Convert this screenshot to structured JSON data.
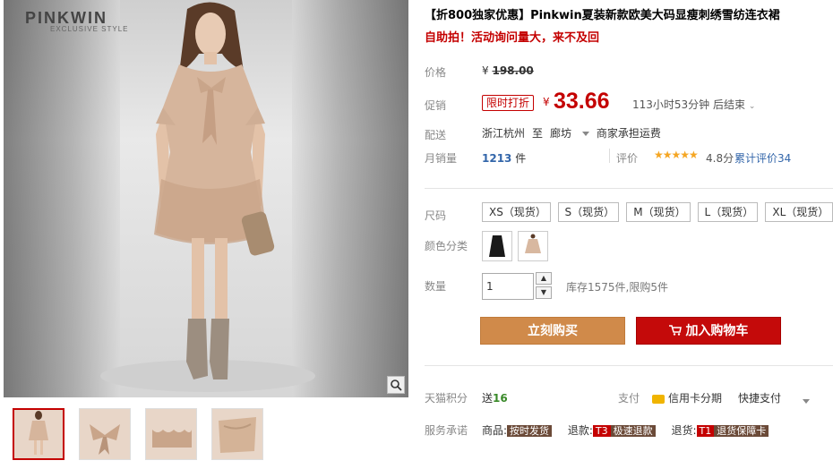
{
  "gallery": {
    "brand": "PINKWIN",
    "brand_sub": "EXCLUSIVE STYLE",
    "zoom_icon": "magnifier-icon",
    "thumbnails": [
      "model-full",
      "bow-detail",
      "ruffle-detail",
      "fabric-detail"
    ]
  },
  "product": {
    "title": "【折800独家优惠】Pinkwin夏装新款欧美大码显瘦刺绣雪纺连衣裙",
    "subtitle": "自助拍！活动询问量大，来不及回"
  },
  "price": {
    "label": "价格",
    "currency": "¥",
    "original": "198.00"
  },
  "promo": {
    "label": "促销",
    "badge": "限时打折",
    "currency": "¥",
    "price": "33.66",
    "countdown": "113小时53分钟 后结束"
  },
  "shipping": {
    "label": "配送",
    "from": "浙江杭州",
    "to_word": "至",
    "to": "廊坊",
    "fee": "商家承担运费"
  },
  "sales": {
    "label": "月销量",
    "count": "1213",
    "unit": "件",
    "rating_label": "评价",
    "stars": "★★★★★",
    "score": "4.8分",
    "reviews": "累计评价34"
  },
  "options": {
    "size_label": "尺码",
    "sizes": [
      "XS（现货）",
      "S（现货）",
      "M（现货）",
      "L（现货）",
      "XL（现货）"
    ],
    "color_label": "颜色分类",
    "colors": [
      "#1a1a1a",
      "#d8b8a0"
    ]
  },
  "quantity": {
    "label": "数量",
    "value": "1",
    "up": "▲",
    "down": "▼",
    "stock": "库存1575件,限购5件"
  },
  "actions": {
    "buy": "立刻购买",
    "cart": "加入购物车"
  },
  "extras": {
    "points_label": "天猫积分",
    "points_prefix": "送",
    "points": "16",
    "pay_label": "支付",
    "card": "信用卡分期",
    "quickpay": "快捷支付",
    "service_label": "服务承诺",
    "svc1_prefix": "商品:",
    "svc1_tag": "按时发货",
    "svc2_prefix": "退款:",
    "svc2_code": "T3",
    "svc2_tag": "极速退款",
    "svc3_prefix": "退货:",
    "svc3_code": "T1",
    "svc3_tag": "退货保障卡"
  }
}
